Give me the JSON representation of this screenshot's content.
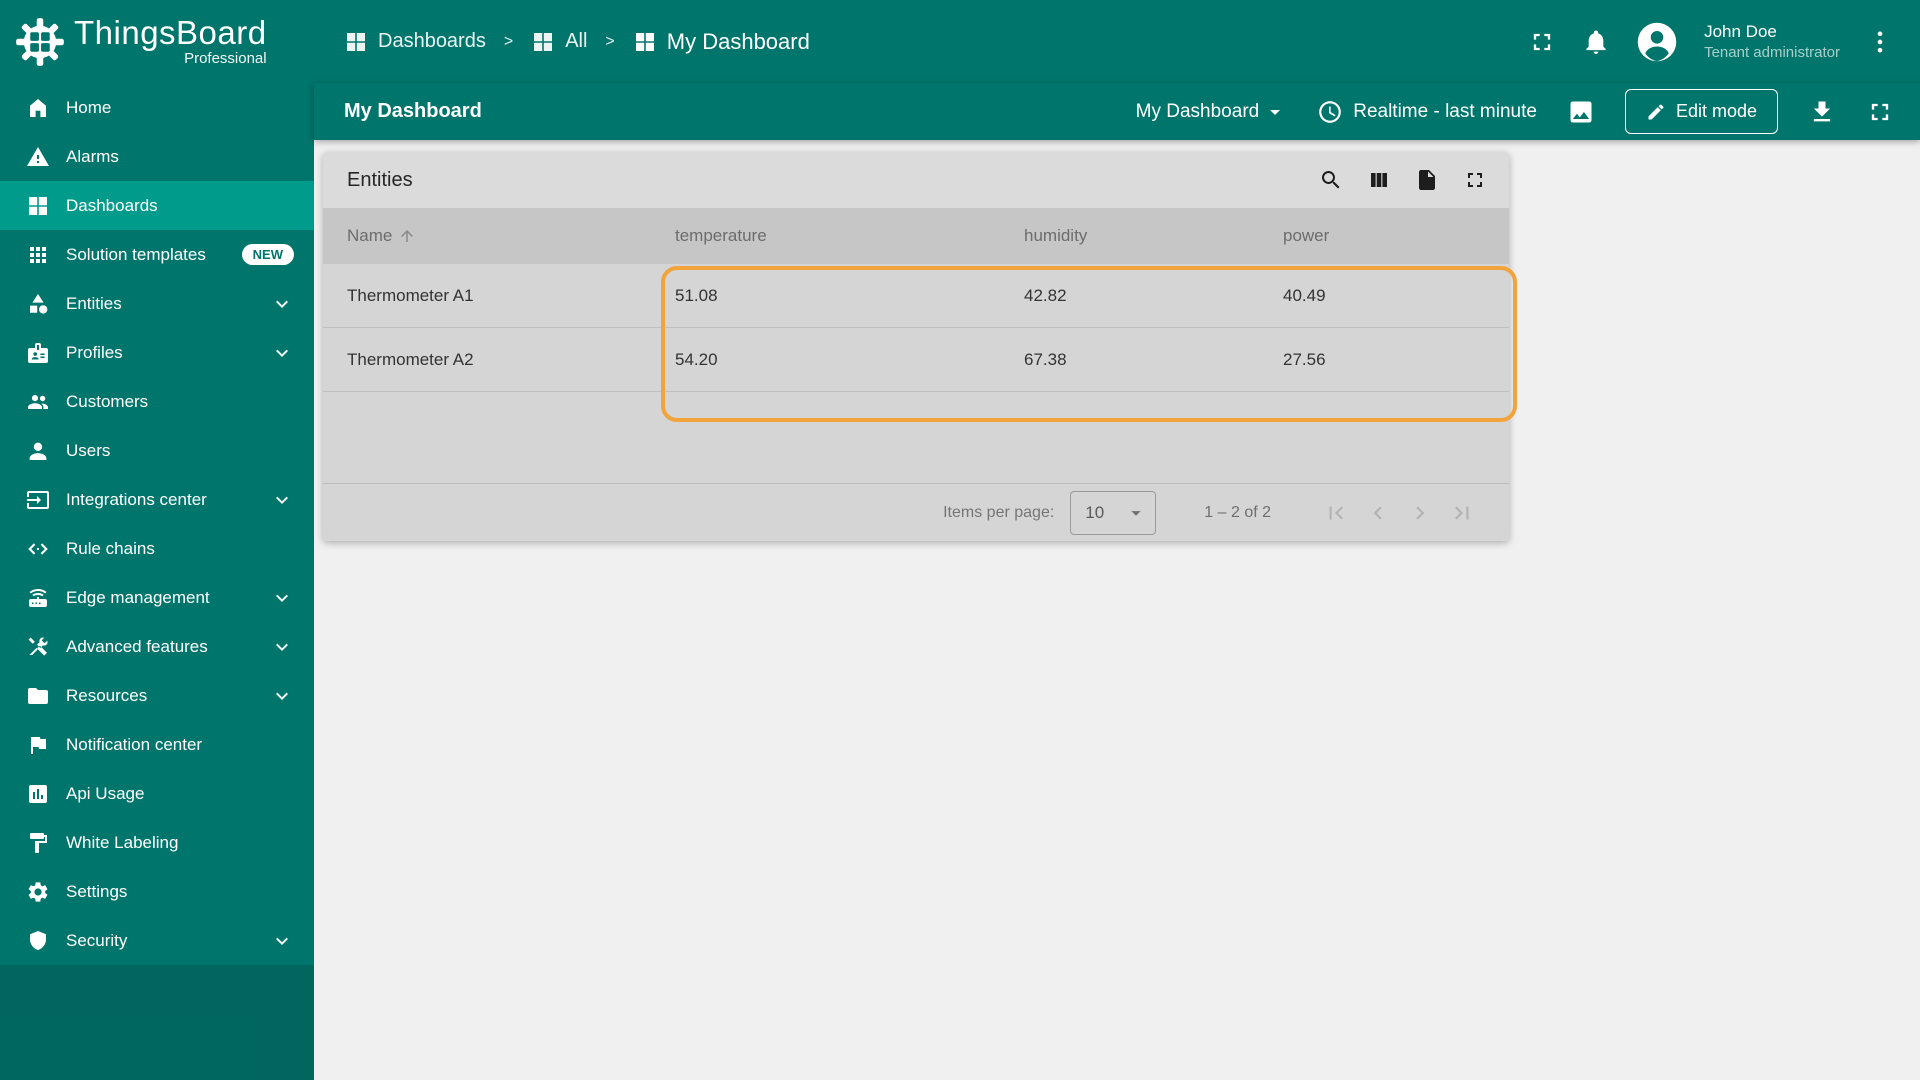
{
  "app": {
    "name": "ThingsBoard",
    "edition": "Professional"
  },
  "header": {
    "breadcrumb": [
      {
        "label": "Dashboards"
      },
      {
        "label": "All"
      },
      {
        "label": "My Dashboard"
      }
    ],
    "separator": ">",
    "user": {
      "name": "John Doe",
      "role": "Tenant administrator"
    }
  },
  "sidebar": {
    "items": [
      {
        "label": "Home"
      },
      {
        "label": "Alarms"
      },
      {
        "label": "Dashboards",
        "active": true
      },
      {
        "label": "Solution templates",
        "badge": "NEW"
      },
      {
        "label": "Entities",
        "expandable": true
      },
      {
        "label": "Profiles",
        "expandable": true
      },
      {
        "label": "Customers"
      },
      {
        "label": "Users"
      },
      {
        "label": "Integrations center",
        "expandable": true
      },
      {
        "label": "Rule chains"
      },
      {
        "label": "Edge management",
        "expandable": true
      },
      {
        "label": "Advanced features",
        "expandable": true
      },
      {
        "label": "Resources",
        "expandable": true
      },
      {
        "label": "Notification center"
      },
      {
        "label": "Api Usage"
      },
      {
        "label": "White Labeling"
      },
      {
        "label": "Settings"
      },
      {
        "label": "Security",
        "expandable": true
      }
    ]
  },
  "toolbar": {
    "title": "My Dashboard",
    "dashboard_select": "My Dashboard",
    "timewindow": "Realtime - last minute",
    "edit_label": "Edit mode"
  },
  "widget": {
    "title": "Entities",
    "table": {
      "columns": [
        "Name",
        "temperature",
        "humidity",
        "power"
      ],
      "rows": [
        {
          "name": "Thermometer A1",
          "temperature": "51.08",
          "humidity": "42.82",
          "power": "40.49"
        },
        {
          "name": "Thermometer A2",
          "temperature": "54.20",
          "humidity": "67.38",
          "power": "27.56"
        }
      ]
    },
    "pagination": {
      "items_per_page_label": "Items per page:",
      "items_per_page_value": "10",
      "range_label": "1 – 2 of 2"
    }
  },
  "colors": {
    "primary": "#00756b",
    "active_item": "#009b8b",
    "highlight": "#f2a33c",
    "content_bg": "#f0f0f0",
    "widget_bg": "#dbdbdb"
  }
}
